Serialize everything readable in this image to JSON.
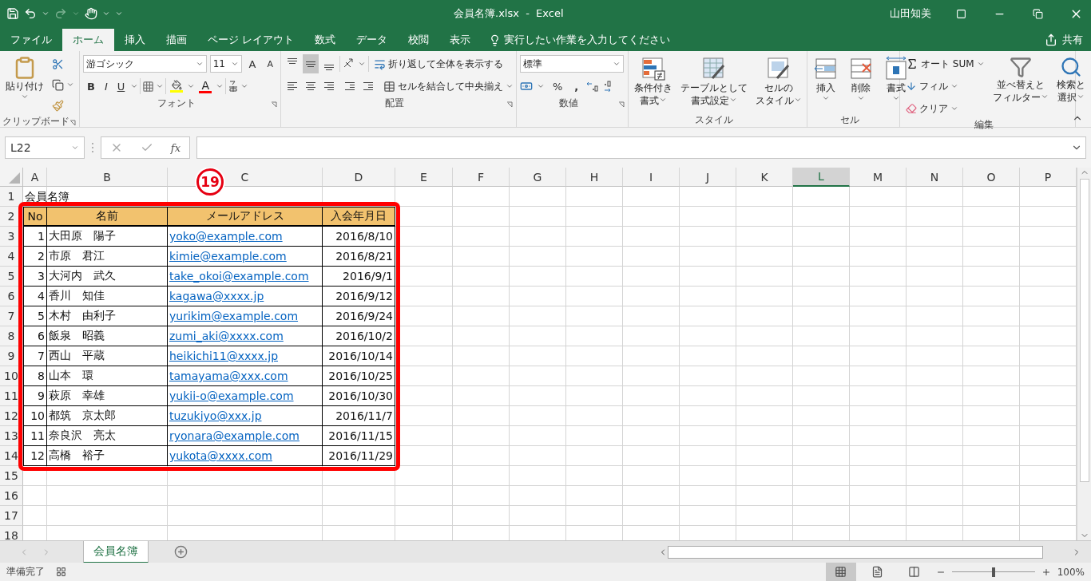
{
  "window": {
    "title": "会員名簿.xlsx  -  Excel",
    "user": "山田知美"
  },
  "ribbon_tabs": [
    {
      "label": "ファイル",
      "selected": false
    },
    {
      "label": "ホーム",
      "selected": true
    },
    {
      "label": "挿入",
      "selected": false
    },
    {
      "label": "描画",
      "selected": false
    },
    {
      "label": "ページ レイアウト",
      "selected": false
    },
    {
      "label": "数式",
      "selected": false
    },
    {
      "label": "データ",
      "selected": false
    },
    {
      "label": "校閲",
      "selected": false
    },
    {
      "label": "表示",
      "selected": false
    }
  ],
  "tell_me": {
    "placeholder": "実行したい作業を入力してください"
  },
  "share": "共有",
  "ribbon": {
    "clipboard": {
      "label": "クリップボード",
      "paste": "貼り付け"
    },
    "font": {
      "label": "フォント",
      "font_name": "游ゴシック",
      "font_size": "11",
      "grow": "A",
      "shrink": "A",
      "bold": "B",
      "italic": "I",
      "underline": "U",
      "font_color": "A"
    },
    "alignment": {
      "label": "配置",
      "vertical": [
        {
          "kind": "top",
          "selected": false
        },
        {
          "kind": "middle",
          "selected": true
        },
        {
          "kind": "bottom",
          "selected": false
        }
      ],
      "wrap": "折り返して全体を表示する",
      "merge": "セルを結合して中央揃え"
    },
    "number": {
      "label": "数値",
      "format": "標準",
      "percent": "%",
      "comma": ","
    },
    "styles": {
      "label": "スタイル",
      "buttons": [
        {
          "kind": "conditional",
          "lines": [
            "条件付き",
            "書式"
          ]
        },
        {
          "kind": "table",
          "lines": [
            "テーブルとして",
            "書式設定"
          ]
        },
        {
          "kind": "cell",
          "lines": [
            "セルの",
            "スタイル"
          ]
        }
      ]
    },
    "cells": {
      "label": "セル",
      "buttons": [
        {
          "kind": "insert",
          "label": "挿入"
        },
        {
          "kind": "delete",
          "label": "削除"
        },
        {
          "kind": "format",
          "label": "書式"
        }
      ]
    },
    "editing": {
      "label": "編集",
      "autosum": "オート SUM",
      "fill": "フィル",
      "clear": "クリア",
      "sort": [
        "並べ替えと",
        "フィルター"
      ],
      "find": [
        "検索と",
        "選択"
      ]
    }
  },
  "formula_bar": {
    "name_box": "L22",
    "fx": "fx"
  },
  "columns": [
    {
      "label": "A",
      "selected": false
    },
    {
      "label": "B",
      "selected": false
    },
    {
      "label": "C",
      "selected": false
    },
    {
      "label": "D",
      "selected": false
    },
    {
      "label": "E",
      "selected": false
    },
    {
      "label": "F",
      "selected": false
    },
    {
      "label": "G",
      "selected": false
    },
    {
      "label": "H",
      "selected": false
    },
    {
      "label": "I",
      "selected": false
    },
    {
      "label": "J",
      "selected": false
    },
    {
      "label": "K",
      "selected": false
    },
    {
      "label": "L",
      "selected": true
    },
    {
      "label": "M",
      "selected": false
    },
    {
      "label": "N",
      "selected": false
    },
    {
      "label": "O",
      "selected": false
    },
    {
      "label": "P",
      "selected": false
    }
  ],
  "rows": [
    "1",
    "2",
    "3",
    "4",
    "5",
    "6",
    "7",
    "8",
    "9",
    "10",
    "11",
    "12",
    "13",
    "14",
    "15",
    "16",
    "17",
    "18"
  ],
  "sheet": {
    "title": "会員名簿",
    "headers": [
      "No",
      "名前",
      "メールアドレス",
      "入会年月日"
    ],
    "records": [
      {
        "no": "1",
        "name": "大田原　陽子",
        "email": "yoko@example.com",
        "date": "2016/8/10"
      },
      {
        "no": "2",
        "name": "市原　君江",
        "email": "kimie@example.com",
        "date": "2016/8/21"
      },
      {
        "no": "3",
        "name": "大河内　武久",
        "email": "take_okoi@example.com",
        "date": "2016/9/1"
      },
      {
        "no": "4",
        "name": "香川　知佳",
        "email": "kagawa@xxxx.jp",
        "date": "2016/9/12"
      },
      {
        "no": "5",
        "name": "木村　由利子",
        "email": "yurikim@example.com",
        "date": "2016/9/24"
      },
      {
        "no": "6",
        "name": "飯泉　昭義",
        "email": "zumi_aki@xxxx.com",
        "date": "2016/10/2"
      },
      {
        "no": "7",
        "name": "西山　平蔵",
        "email": "heikichi11@xxxx.jp",
        "date": "2016/10/14"
      },
      {
        "no": "8",
        "name": "山本　環",
        "email": "tamayama@xxx.com",
        "date": "2016/10/25"
      },
      {
        "no": "9",
        "name": "萩原　幸雄",
        "email": "yukii-o@example.com",
        "date": "2016/10/30"
      },
      {
        "no": "10",
        "name": "都筑　京太郎",
        "email": "tuzukiyo@xxx.jp",
        "date": "2016/11/7"
      },
      {
        "no": "11",
        "name": "奈良沢　亮太",
        "email": "ryonara@example.com",
        "date": "2016/11/15"
      },
      {
        "no": "12",
        "name": "高橋　裕子",
        "email": "yukota@xxxx.com",
        "date": "2016/11/29"
      }
    ]
  },
  "annotation": "19",
  "sheet_tabs": [
    {
      "label": "会員名簿",
      "selected": true
    }
  ],
  "status_bar": {
    "status": "準備完了",
    "views": [
      {
        "kind": "normal",
        "selected": true
      },
      {
        "kind": "page_layout",
        "selected": false
      },
      {
        "kind": "page_break",
        "selected": false
      }
    ],
    "zoom": {
      "level": 0.5,
      "reading": "100%"
    }
  }
}
